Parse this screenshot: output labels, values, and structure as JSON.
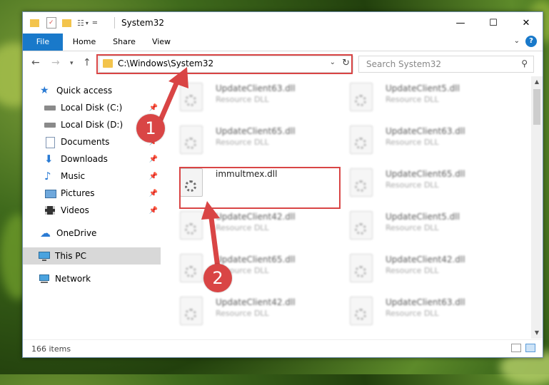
{
  "window": {
    "title": "System32",
    "controls": {
      "minimize": "—",
      "maximize": "☐",
      "close": "✕"
    }
  },
  "ribbon": {
    "tabs": [
      "File",
      "Home",
      "Share",
      "View"
    ],
    "help": "?"
  },
  "nav": {
    "address": "C:\\Windows\\System32",
    "search_placeholder": "Search System32"
  },
  "sidebar": {
    "items": [
      {
        "label": "Quick access",
        "icon": "star-icon",
        "pinned": false
      },
      {
        "label": "Local Disk (C:)",
        "icon": "drive-icon",
        "pinned": true
      },
      {
        "label": "Local Disk (D:)",
        "icon": "drive-icon",
        "pinned": true
      },
      {
        "label": "Documents",
        "icon": "documents-icon",
        "pinned": true
      },
      {
        "label": "Downloads",
        "icon": "download-icon",
        "pinned": true
      },
      {
        "label": "Music",
        "icon": "music-icon",
        "pinned": true
      },
      {
        "label": "Pictures",
        "icon": "pictures-icon",
        "pinned": true
      },
      {
        "label": "Videos",
        "icon": "videos-icon",
        "pinned": true
      },
      {
        "label": "OneDrive",
        "icon": "cloud-icon",
        "pinned": false
      },
      {
        "label": "This PC",
        "icon": "monitor-icon",
        "pinned": false,
        "selected": true
      },
      {
        "label": "Network",
        "icon": "network-icon",
        "pinned": false
      }
    ]
  },
  "files": {
    "left_column": [
      {
        "name": "UpdateClient63.dll",
        "desc": "Resource DLL"
      },
      {
        "name": "UpdateClient65.dll",
        "desc": "Resource DLL"
      },
      {
        "name": "immultmex.dll",
        "desc": ""
      },
      {
        "name": "UpdateClient42.dll",
        "desc": "Resource DLL"
      },
      {
        "name": "UpdateClient65.dll",
        "desc": "Resource DLL"
      },
      {
        "name": "UpdateClient42.dll",
        "desc": "Resource DLL"
      }
    ],
    "right_column": [
      {
        "name": "UpdateClient5.dll",
        "desc": "Resource DLL"
      },
      {
        "name": "UpdateClient63.dll",
        "desc": "Resource DLL"
      },
      {
        "name": "UpdateClient65.dll",
        "desc": "Resource DLL"
      },
      {
        "name": "UpdateClient5.dll",
        "desc": "Resource DLL"
      },
      {
        "name": "UpdateClient42.dll",
        "desc": "Resource DLL"
      },
      {
        "name": "UpdateClient63.dll",
        "desc": "Resource DLL"
      }
    ]
  },
  "status": {
    "count": "166 items"
  },
  "callouts": {
    "one": "1",
    "two": "2"
  },
  "colors": {
    "accent": "#1979ca",
    "highlight": "#d94545"
  }
}
